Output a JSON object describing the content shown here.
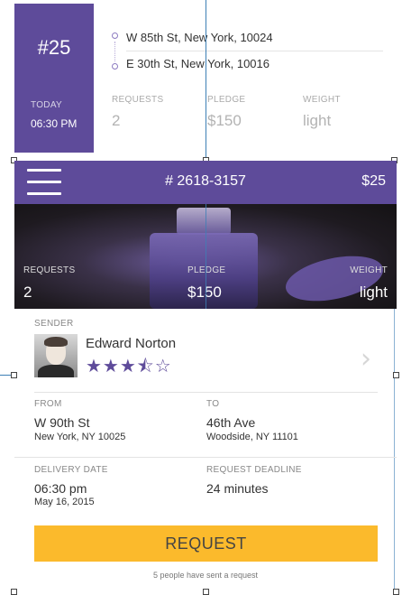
{
  "top_card": {
    "number": "#25",
    "day_label": "TODAY",
    "time": "06:30 PM",
    "address_from": "W 85th St, New York, 10024",
    "address_to": "E 30th St, New York, 10016",
    "stats": [
      {
        "label": "REQUESTS",
        "value": "2"
      },
      {
        "label": "PLEDGE",
        "value": "$150"
      },
      {
        "label": "WEIGHT",
        "value": "light"
      }
    ]
  },
  "header": {
    "title": "# 2618-3157",
    "price": "$25",
    "menu_icon": "hamburger-icon"
  },
  "hero": {
    "stats": [
      {
        "label": "REQUESTS",
        "value": "2"
      },
      {
        "label": "PLEDGE",
        "value": "$150"
      },
      {
        "label": "WEIGHT",
        "value": "light"
      }
    ]
  },
  "sender": {
    "section_label": "SENDER",
    "name": "Edward Norton",
    "rating": "★★★⯪☆",
    "rating_value": 3.5,
    "chevron_icon": "chevron-right-icon"
  },
  "route": {
    "from_label": "FROM",
    "from_street": "W 90th St",
    "from_city": "New York, NY 10025",
    "to_label": "TO",
    "to_street": "46th Ave",
    "to_city": "Woodside, NY 11101"
  },
  "schedule": {
    "delivery_label": "DELIVERY DATE",
    "delivery_time": "06:30 pm",
    "delivery_date": "May 16, 2015",
    "deadline_label": "REQUEST DEADLINE",
    "deadline_value": "24 minutes"
  },
  "action": {
    "button_label": "REQUEST",
    "note": "5 people have sent a request",
    "button_color": "#fbba2c"
  },
  "colors": {
    "accent": "#5e4b9a"
  }
}
